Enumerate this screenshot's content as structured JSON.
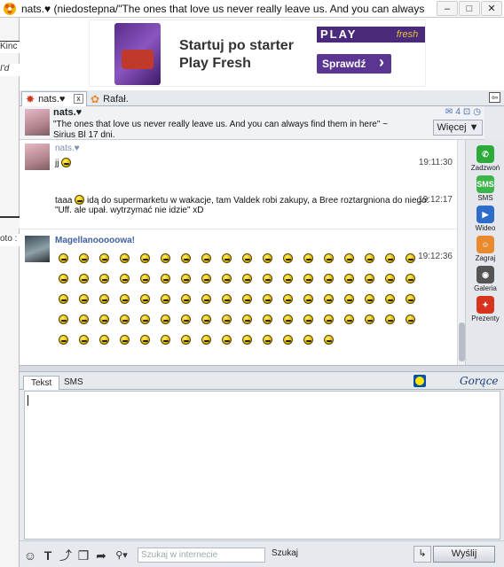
{
  "window": {
    "title": "nats.♥ (niedostepna/\"The ones that love us never really leave us. And you can always find th...",
    "min": "–",
    "max": "□",
    "close": "✕"
  },
  "background_window": {
    "fragments": [
      "Kinc",
      "I'd",
      "oto :"
    ]
  },
  "ad": {
    "line1": "Startuj po starter",
    "line2": "Play Fresh",
    "brand": "PLAY",
    "brand2": "fresh",
    "cta": "Sprawdź"
  },
  "tabs": [
    {
      "label": "nats.♥",
      "active": true
    },
    {
      "label": "Rafał.",
      "active": false
    }
  ],
  "tab_close": "x",
  "contact": {
    "name": "nats.♥",
    "description": "\"The ones that love us never really leave us. And you can always find them in here\" ~ Sirius Bl 17 dni.",
    "count": "4",
    "more_label": "Więcej ▼"
  },
  "messages": [
    {
      "sender": "nats.♥",
      "time": "19:11:30",
      "text": "jj"
    },
    {
      "sender": "",
      "time": "19:12:17",
      "text_before": "taaa",
      "text_after": "idą do supermarketu w wakacje, tam Valdek robi zakupy, a Bree roztargniona do niego:",
      "text_line2": "\"Uff. ale upał. wytrzymać nie idzie\" xD"
    },
    {
      "sender": "Magellanooooowa!",
      "time": "19:12:36",
      "emoticon_count": 86
    }
  ],
  "side_apps": [
    {
      "label": "Zadzwoń",
      "color": "#2eaa3a",
      "icon_name": "phone-icon",
      "glyph": "✆"
    },
    {
      "label": "SMS",
      "color": "#3cb54a",
      "icon_name": "sms-icon",
      "glyph": "SMS"
    },
    {
      "label": "Wideo",
      "color": "#2d6cc8",
      "icon_name": "video-icon",
      "glyph": "▶"
    },
    {
      "label": "Zagraj",
      "color": "#e98a2e",
      "icon_name": "game-icon",
      "glyph": "☺"
    },
    {
      "label": "Galeria",
      "color": "#555555",
      "icon_name": "camera-icon",
      "glyph": "◉"
    },
    {
      "label": "Prezenty",
      "color": "#d8331f",
      "icon_name": "gift-icon",
      "glyph": "✦"
    }
  ],
  "compose": {
    "tabs": [
      "Tekst",
      "SMS"
    ],
    "hot_label": "Gorące"
  },
  "toolbar": {
    "icons": [
      {
        "name": "emoticon-icon",
        "glyph": "☺"
      },
      {
        "name": "text-format-icon",
        "glyph": "T"
      },
      {
        "name": "link-icon",
        "glyph": "⤴"
      },
      {
        "name": "gift-small-icon",
        "glyph": "❒"
      },
      {
        "name": "share-icon",
        "glyph": "➦"
      },
      {
        "name": "search-menu-icon",
        "glyph": "⚲▾"
      }
    ],
    "search_placeholder": "Szukaj w internecie",
    "search_button": "Szukaj",
    "send_aux": "↳",
    "send_label": "Wyślij"
  }
}
